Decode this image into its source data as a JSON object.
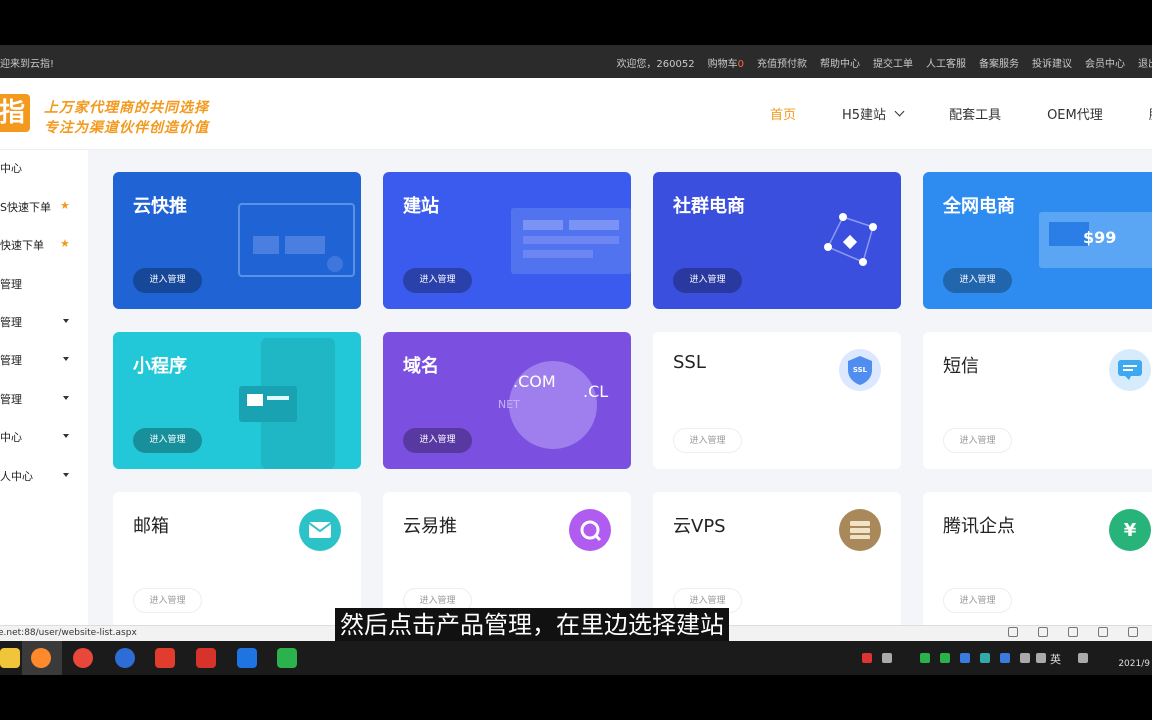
{
  "topbar": {
    "welcome": "迎来到云指!",
    "links": [
      "欢迎您，260052",
      "购物车",
      "充值预付款",
      "帮助中心",
      "提交工单",
      "人工客服",
      "备案服务",
      "投诉建议",
      "会员中心",
      "退出"
    ],
    "cart_count": "0"
  },
  "header": {
    "logo_char": "指",
    "slogan_line1": "上万家代理商的共同选择",
    "slogan_line2": "专注为渠道伙伴创造价值",
    "nav": [
      {
        "label": "首页",
        "active": true
      },
      {
        "label": "H5建站",
        "dropdown": true
      },
      {
        "label": "配套工具"
      },
      {
        "label": "OEM代理"
      },
      {
        "label": "服"
      }
    ]
  },
  "sidebar": {
    "items": [
      {
        "label": "中心"
      },
      {
        "label": "S快速下单",
        "star": true
      },
      {
        "label": "快速下单",
        "star": true
      },
      {
        "label": "管理"
      },
      {
        "label": "管理",
        "caret": true
      },
      {
        "label": "管理",
        "caret": true
      },
      {
        "label": "管理",
        "caret": true
      },
      {
        "label": "中心",
        "caret": true
      },
      {
        "label": "人中心",
        "caret": true
      }
    ]
  },
  "cards": [
    {
      "title": "云快推",
      "button": "进入管理",
      "bg": "#1f63d4"
    },
    {
      "title": "建站",
      "button": "进入管理",
      "bg": "#3b5bee"
    },
    {
      "title": "社群电商",
      "button": "进入管理",
      "bg": "#3a4fde"
    },
    {
      "title": "全网电商",
      "button": "进入管理",
      "bg": "#2e8cf0",
      "price": "$99"
    },
    {
      "title": "小程序",
      "button": "进入管理",
      "bg": "#22c8d8"
    },
    {
      "title": "域名",
      "button": "进入管理",
      "bg": "#7b4fe0",
      "com": ".COM",
      "cl": ".CL",
      "net": "NET"
    },
    {
      "title": "SSL",
      "button": "进入管理",
      "icon_text": "SSL",
      "icon_color": "#4f8ef0"
    },
    {
      "title": "短信",
      "button": "进入管理",
      "icon_color": "#3fa9f0"
    },
    {
      "title": "邮箱",
      "button": "进入管理",
      "icon_color": "#2cc3c8"
    },
    {
      "title": "云易推",
      "button": "进入管理",
      "icon_color": "#b05cf0"
    },
    {
      "title": "云VPS",
      "button": "进入管理",
      "icon_color": "#a9885a"
    },
    {
      "title": "腾讯企点",
      "button": "进入管理",
      "icon_color": "#28b37a",
      "icon_text": "¥"
    }
  ],
  "status": {
    "url": "e.net:88/user/website-list.aspx"
  },
  "subtitle": "然后点击产品管理，在里边选择建站",
  "taskbar": {
    "lang": "英",
    "clock": "2021/9"
  }
}
